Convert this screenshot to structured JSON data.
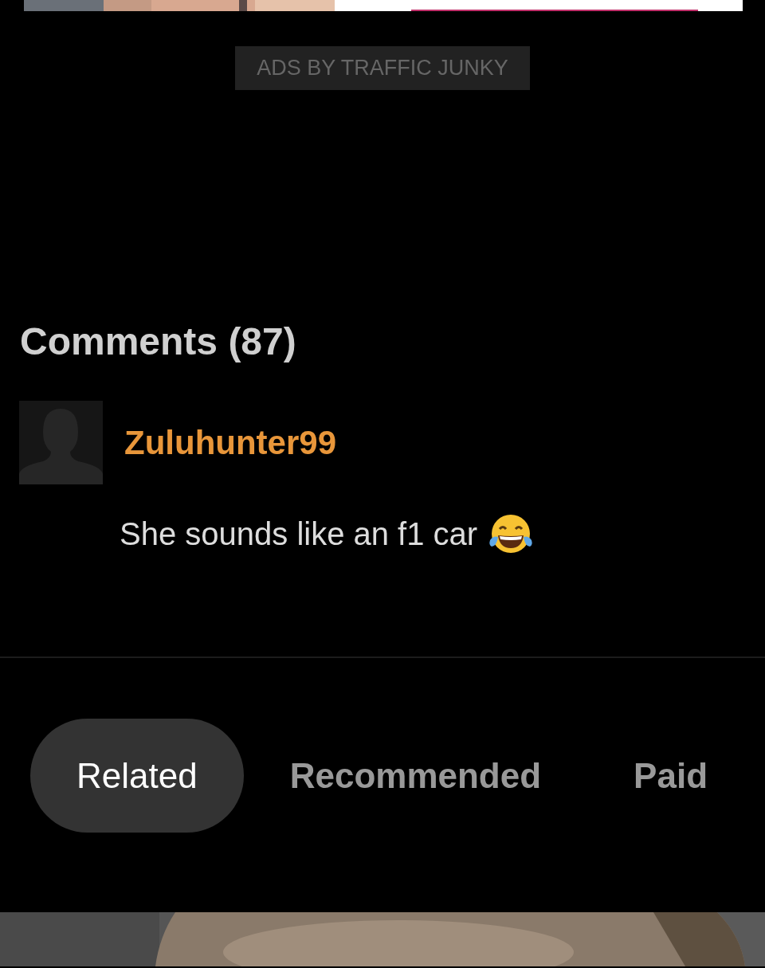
{
  "ad_label": "ADS BY TRAFFIC JUNKY",
  "comments": {
    "heading": "Comments (87)",
    "items": [
      {
        "username": "Zuluhunter99",
        "text": "She sounds like an f1 car"
      }
    ]
  },
  "tabs": [
    {
      "label": "Related",
      "selected": true
    },
    {
      "label": "Recommended",
      "selected": false
    },
    {
      "label": "Paid",
      "selected": false
    }
  ]
}
